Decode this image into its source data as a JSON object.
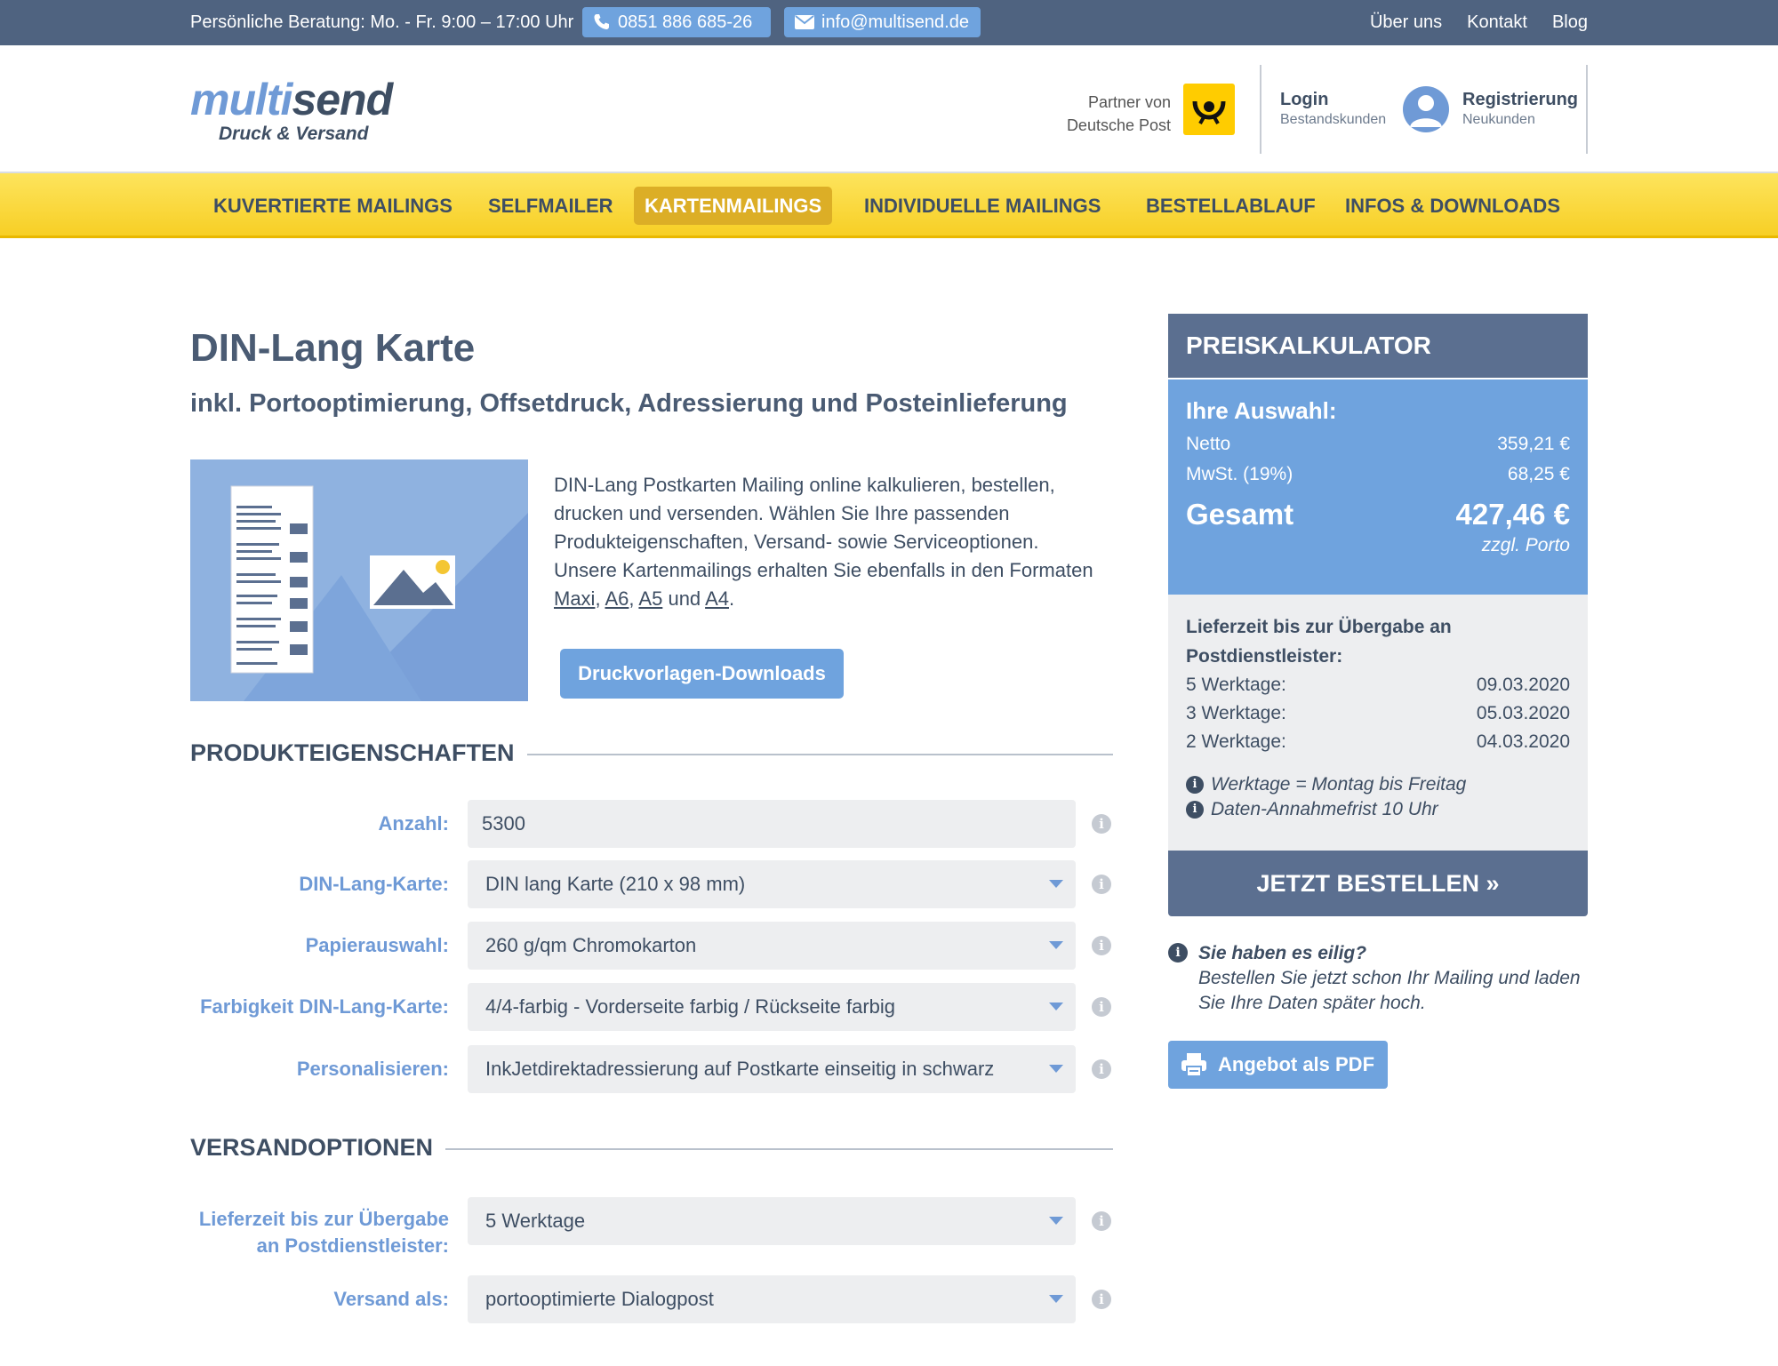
{
  "topbar": {
    "hint": "Persönliche Beratung: Mo. - Fr. 9:00 – 17:00 Uhr",
    "phone": "0851 886 685-26",
    "email": "info@multisend.de",
    "links": [
      "Über uns",
      "Kontakt",
      "Blog"
    ]
  },
  "header": {
    "logo_a": "multi",
    "logo_b": "send",
    "logo_sub": "Druck & Versand",
    "partner_line1": "Partner von",
    "partner_line2": "Deutsche Post",
    "login_title": "Login",
    "login_sub": "Bestandskunden",
    "register_title": "Registrierung",
    "register_sub": "Neukunden"
  },
  "nav": {
    "items": [
      "KUVERTIERTE MAILINGS",
      "SELFMAILER",
      "KARTENMAILINGS",
      "INDIVIDUELLE MAILINGS",
      "BESTELLABLAUF",
      "INFOS & DOWNLOADS"
    ],
    "active": "KARTENMAILINGS"
  },
  "product": {
    "title": "DIN-Lang Karte",
    "subtitle": "inkl. Portooptimierung, Offsetdruck, Adressierung und Posteinlieferung",
    "description": "DIN-Lang Postkarten Mailing online kalkulieren, bestellen, drucken und versenden. Wählen Sie Ihre passenden Produkteigenschaften, Versand- sowie Serviceoptionen. Unsere Kartenmailings erhalten Sie ebenfalls in den Formaten",
    "formats": [
      "Maxi",
      "A6",
      "A5",
      "A4"
    ],
    "and_word": "und",
    "download_button": "Druckvorlagen-Downloads"
  },
  "properties": {
    "heading": "PRODUKTEIGENSCHAFTEN",
    "rows": [
      {
        "label": "Anzahl:",
        "value": "5300"
      },
      {
        "label": "DIN-Lang-Karte:",
        "value": "DIN lang Karte (210 x 98 mm)"
      },
      {
        "label": "Papierauswahl:",
        "value": "260 g/qm Chromokarton"
      },
      {
        "label": "Farbigkeit DIN-Lang-Karte:",
        "value": "4/4-farbig - Vorderseite farbig / Rückseite farbig"
      },
      {
        "label": "Personalisieren:",
        "value": "InkJetdirektadressierung auf Postkarte einseitig in schwarz"
      }
    ]
  },
  "shipping": {
    "heading": "VERSANDOPTIONEN",
    "rows": [
      {
        "label_line1": "Lieferzeit bis zur Übergabe",
        "label_line2": "an Postdienstleister:",
        "value": "5 Werktage"
      },
      {
        "label": "Versand als:",
        "value": "portooptimierte Dialogpost"
      }
    ]
  },
  "calculator": {
    "title": "PREISKALKULATOR",
    "selection_label": "Ihre Auswahl:",
    "net_label": "Netto",
    "net_value": "359,21 €",
    "vat_label": "MwSt. (19%)",
    "vat_value": "68,25 €",
    "total_label": "Gesamt",
    "total_value": "427,46 €",
    "porto_note": "zzgl. Porto",
    "delivery_title": "Lieferzeit bis zur Übergabe an Postdienstleister:",
    "delivery_rows": [
      {
        "label": "5 Werktage:",
        "date": "09.03.2020"
      },
      {
        "label": "3 Werktage:",
        "date": "05.03.2020"
      },
      {
        "label": "2 Werktage:",
        "date": "04.03.2020"
      }
    ],
    "note1": "Werktage = Montag bis Freitag",
    "note2": "Daten-Annahmefrist 10 Uhr",
    "order_button": "JETZT BESTELLEN »"
  },
  "hurry": {
    "title": "Sie haben es eilig?",
    "text": "Bestellen Sie jetzt schon Ihr Mailing und laden Sie Ihre Daten später hoch."
  },
  "pdf_button": "Angebot als PDF",
  "colors": {
    "topbar": "#4f6380",
    "accent_blue": "#6fa3de",
    "nav_yellow": "#f7cf25",
    "nav_active": "#dcae26",
    "dark_blue": "#5b6f90"
  }
}
